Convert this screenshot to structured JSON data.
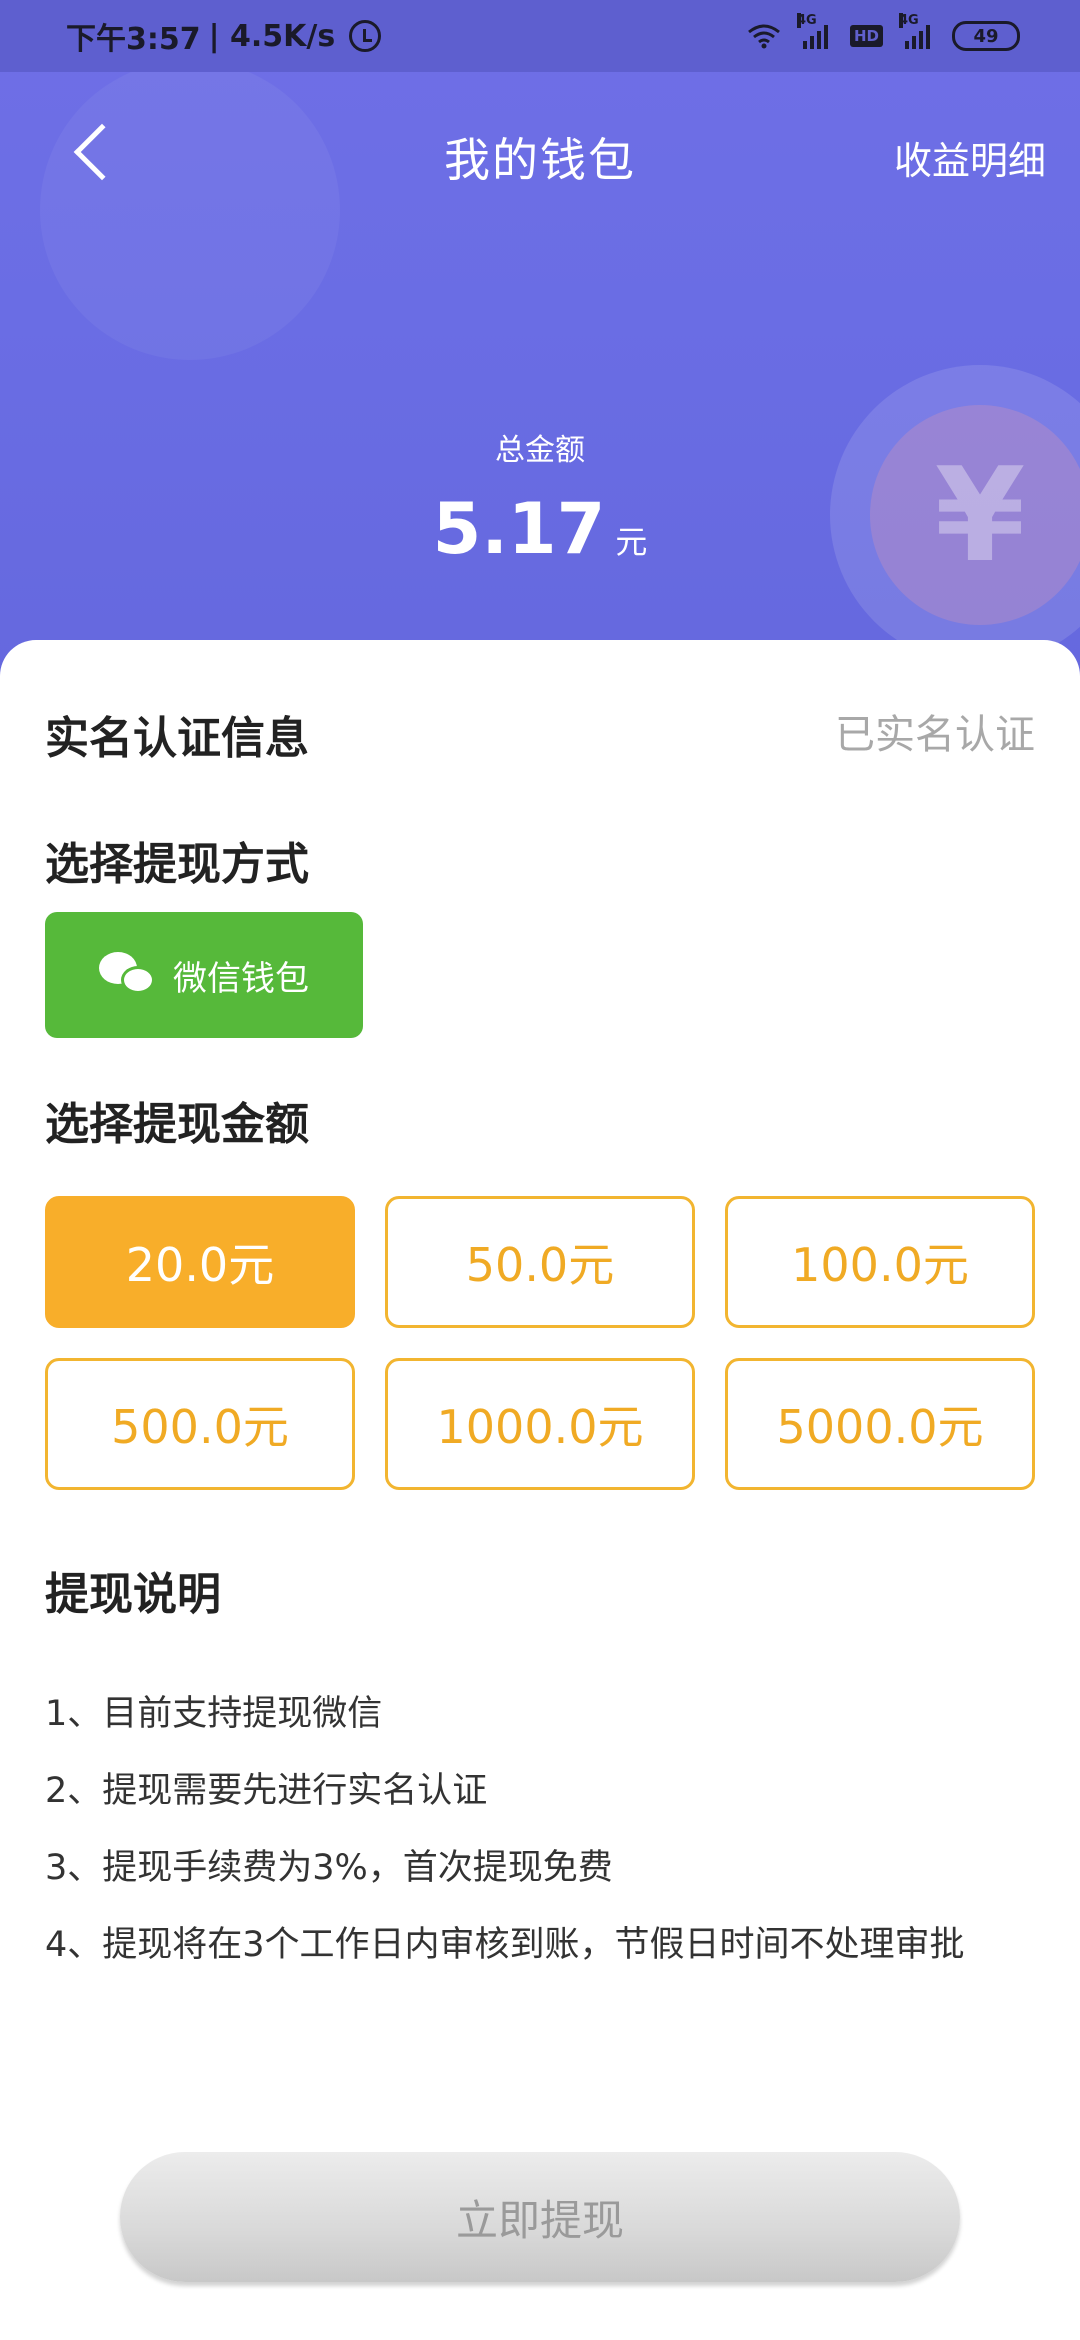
{
  "status_bar": {
    "time": "下午3:57",
    "speed": "| 4.5K/s",
    "sim1_tag": "4G",
    "hd": "HD",
    "sim2_tag": "4G",
    "battery": "49"
  },
  "nav": {
    "title": "我的钱包",
    "right_link": "收益明细"
  },
  "balance": {
    "label": "总金额",
    "value": "5.17",
    "unit": "元",
    "coin_symbol": "¥"
  },
  "verification": {
    "title": "实名认证信息",
    "status": "已实名认证"
  },
  "method": {
    "title": "选择提现方式",
    "option_label": "微信钱包"
  },
  "amount_section": {
    "title": "选择提现金额",
    "options": [
      "20.0元",
      "50.0元",
      "100.0元",
      "500.0元",
      "1000.0元",
      "5000.0元"
    ],
    "selected_index": 0
  },
  "notes": {
    "title": "提现说明",
    "items": [
      "1、目前支持提现微信",
      "2、提现需要先进行实名认证",
      "3、提现手续费为3%，首次提现免费",
      "4、提现将在3个工作日内审核到账，节假日时间不处理审批"
    ]
  },
  "submit_label": "立即提现",
  "colors": {
    "header": "#6a6de4",
    "wechat_green": "#56b93a",
    "amount_orange": "#f8ae2a"
  }
}
